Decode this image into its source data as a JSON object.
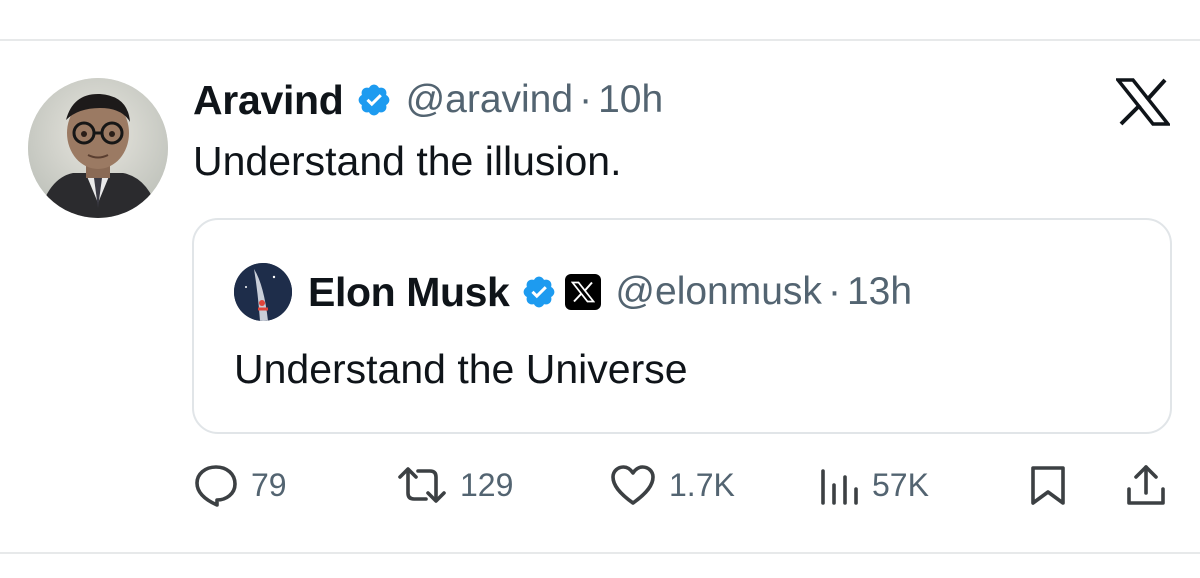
{
  "tweet": {
    "author_name": "Aravind",
    "author_handle": "@aravind",
    "separator": "·",
    "time": "10h",
    "text": "Understand the illusion."
  },
  "quoted_tweet": {
    "author_name": "Elon Musk",
    "author_handle": "@elonmusk",
    "separator": "·",
    "time": "13h",
    "text": "Understand the Universe"
  },
  "actions": {
    "replies": "79",
    "reposts": "129",
    "likes": "1.7K",
    "views": "57K"
  },
  "icons": {
    "verified": "verified-badge-icon",
    "affiliate": "x-affiliation-icon",
    "brand": "x-logo-icon",
    "reply": "reply-icon",
    "repost": "repost-icon",
    "like": "heart-icon",
    "views": "views-chart-icon",
    "bookmark": "bookmark-icon",
    "share": "share-icon"
  },
  "colors": {
    "verified_blue": "#1d9bf0",
    "secondary_text": "#536471",
    "primary_text": "#0f1419",
    "border": "#e1e5e8"
  }
}
